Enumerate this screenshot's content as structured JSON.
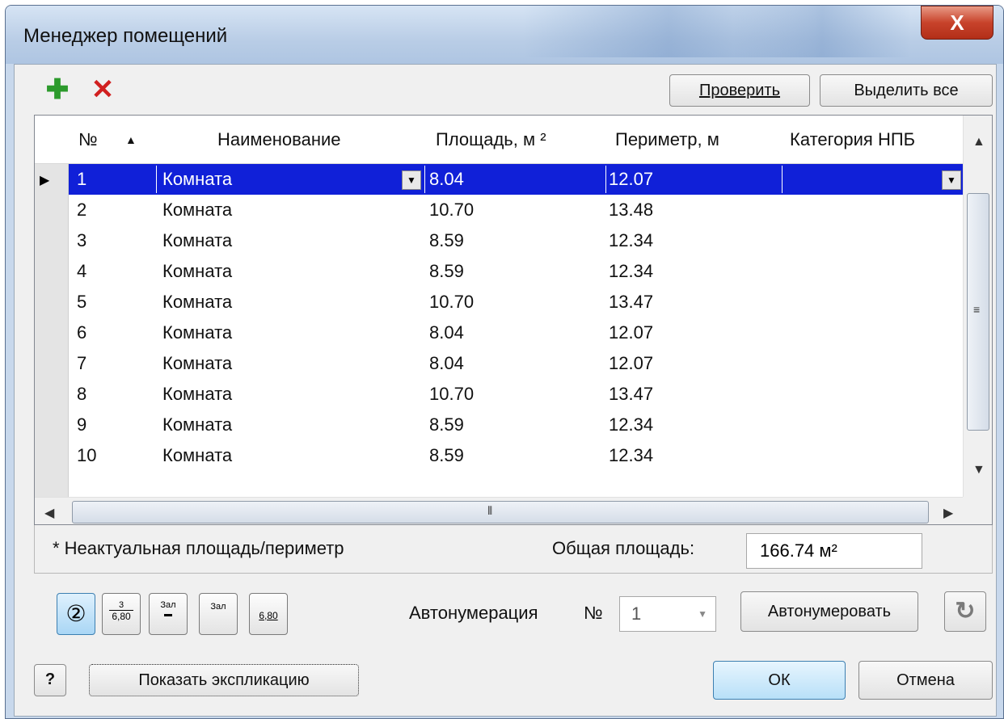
{
  "window": {
    "title": "Менеджер помещений",
    "close_label": "X"
  },
  "toolbar": {
    "check_label": "Проверить",
    "select_all_label": "Выделить все"
  },
  "table": {
    "headers": {
      "num": "№",
      "name": "Наименование",
      "area": "Площадь, м ²",
      "perimeter": "Периметр, м",
      "category": "Категория НПБ"
    },
    "rows": [
      {
        "num": "1",
        "name": "Комната",
        "area": "8.04",
        "perimeter": "12.07",
        "category": ""
      },
      {
        "num": "2",
        "name": "Комната",
        "area": "10.70",
        "perimeter": "13.48",
        "category": ""
      },
      {
        "num": "3",
        "name": "Комната",
        "area": "8.59",
        "perimeter": "12.34",
        "category": ""
      },
      {
        "num": "4",
        "name": "Комната",
        "area": "8.59",
        "perimeter": "12.34",
        "category": ""
      },
      {
        "num": "5",
        "name": "Комната",
        "area": "10.70",
        "perimeter": "13.47",
        "category": ""
      },
      {
        "num": "6",
        "name": "Комната",
        "area": "8.04",
        "perimeter": "12.07",
        "category": ""
      },
      {
        "num": "7",
        "name": "Комната",
        "area": "8.04",
        "perimeter": "12.07",
        "category": ""
      },
      {
        "num": "8",
        "name": "Комната",
        "area": "10.70",
        "perimeter": "13.47",
        "category": ""
      },
      {
        "num": "9",
        "name": "Комната",
        "area": "8.59",
        "perimeter": "12.34",
        "category": ""
      },
      {
        "num": "10",
        "name": "Комната",
        "area": "8.59",
        "perimeter": "12.34",
        "category": ""
      }
    ]
  },
  "status": {
    "legend": "* Неактуальная площадь/периметр",
    "total_label": "Общая площадь:",
    "total_value": "166.74 м²"
  },
  "style_buttons": [
    {
      "top": "",
      "bottom": "②"
    },
    {
      "top": "3",
      "bottom": "6,80"
    },
    {
      "top": "Зал",
      "bottom": "▬"
    },
    {
      "top": "Зал",
      "bottom": ""
    },
    {
      "top": "",
      "bottom": "6,80"
    }
  ],
  "autonumber": {
    "label": "Автонумерация",
    "num_label": "№",
    "value": "1",
    "button_label": "Автонумеровать"
  },
  "footer": {
    "help_label": "?",
    "show_explication_label": "Показать экспликацию",
    "ok_label": "ОК",
    "cancel_label": "Отмена"
  },
  "colors": {
    "selection": "#1020d8",
    "add_icon": "#2c9a2c",
    "delete_icon": "#d12020",
    "ok_highlight": "#c3e6fb"
  }
}
